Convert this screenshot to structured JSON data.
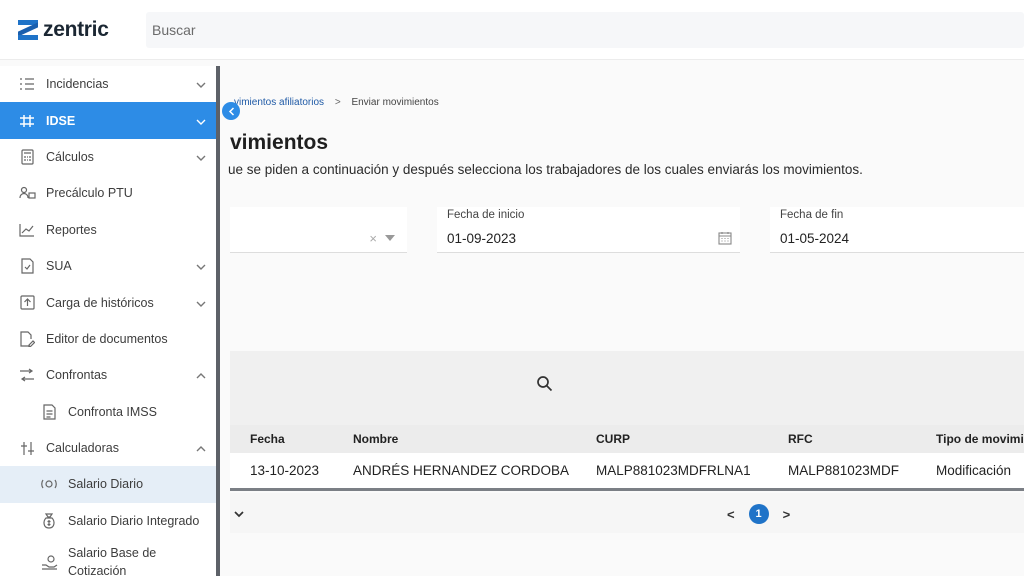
{
  "app": {
    "logo_text": "zentric"
  },
  "search": {
    "placeholder": "Buscar"
  },
  "sidebar": {
    "items": [
      {
        "label": "Incidencias",
        "icon": "list-check-icon"
      },
      {
        "label": "IDSE",
        "icon": "arrows-icon"
      },
      {
        "label": "Cálculos",
        "icon": "calculator-icon"
      },
      {
        "label": "Precálculo PTU",
        "icon": "people-money-icon"
      },
      {
        "label": "Reportes",
        "icon": "chart-line-icon"
      },
      {
        "label": "SUA",
        "icon": "document-check-icon"
      },
      {
        "label": "Carga de históricos",
        "icon": "upload-box-icon"
      },
      {
        "label": "Editor de documentos",
        "icon": "document-edit-icon"
      },
      {
        "label": "Confrontas",
        "icon": "compare-icon"
      },
      {
        "label": "Confronta IMSS",
        "icon": "document-icon"
      },
      {
        "label": "Calculadoras",
        "icon": "sliders-icon"
      },
      {
        "label": "Salario Diario",
        "icon": "money-icon"
      },
      {
        "label": "Salario Diario Integrado",
        "icon": "money-bag-icon"
      },
      {
        "label": "Salario Base de Cotización",
        "icon": "hand-money-icon"
      }
    ]
  },
  "breadcrumb": {
    "parent": "vimientos afiliatorios",
    "separator": ">",
    "current": "Enviar movimientos"
  },
  "page": {
    "title": "vimientos",
    "description": "ue se piden a continuación y después selecciona los trabajadores de los cuales enviarás los movimientos."
  },
  "filters": {
    "clear_glyph": "×",
    "start": {
      "label": "Fecha de inicio",
      "value": "01-09-2023"
    },
    "end": {
      "label": "Fecha de fin",
      "value": "01-05-2024"
    }
  },
  "table": {
    "headers": [
      "Fecha",
      "Nombre",
      "CURP",
      "RFC",
      "Tipo de movimi"
    ],
    "rows": [
      [
        "13-10-2023",
        "ANDRÉS HERNANDEZ CORDOBA",
        "MALP881023MDFRLNA1",
        "MALP881023MDF",
        "Modificación"
      ]
    ]
  },
  "pagination": {
    "prev": "<",
    "current": "1",
    "next": ">"
  },
  "colors": {
    "accent": "#2d8ce6",
    "brand": "#1f73c8"
  }
}
